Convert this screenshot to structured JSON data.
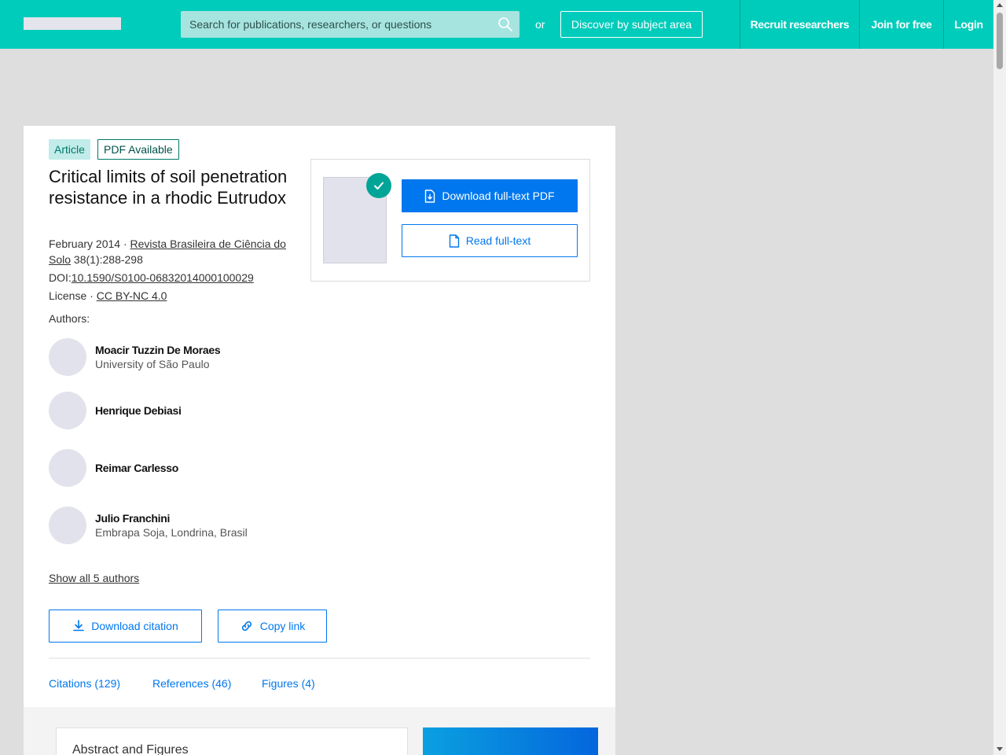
{
  "header": {
    "search_placeholder": "Search for publications, researchers, or questions",
    "or_text": "or",
    "discover_label": "Discover by subject area",
    "nav": {
      "recruit": "Recruit researchers",
      "join": "Join for free",
      "login": "Login"
    }
  },
  "article": {
    "badges": {
      "type": "Article",
      "pdf": "PDF Available"
    },
    "title": "Critical limits of soil penetration resistance in a rhodic Eutrudox",
    "date": "February 2014",
    "separator": " · ",
    "journal": "Revista Brasileira de Ciência do Solo",
    "volume": " 38(1):288-298",
    "doi_label": "DOI:",
    "doi": "10.1590/S0100-06832014000100029",
    "license_label": "License · ",
    "license": "CC BY-NC 4.0",
    "authors_label": "Authors:",
    "authors": [
      {
        "name": "Moacir Tuzzin De Moraes",
        "affiliation": "University of São Paulo"
      },
      {
        "name": "Henrique Debiasi",
        "affiliation": ""
      },
      {
        "name": "Reimar Carlesso",
        "affiliation": ""
      },
      {
        "name": "Julio Franchini",
        "affiliation": "Embrapa Soja, Londrina, Brasil"
      }
    ],
    "show_all": "Show all 5 authors",
    "download_citation": "Download citation",
    "copy_link": "Copy link",
    "tabs": {
      "citations": "Citations (129)",
      "references": "References (46)",
      "figures": "Figures (4)"
    }
  },
  "preview": {
    "download_pdf": "Download full-text PDF",
    "read_fulltext": "Read full-text"
  },
  "lower": {
    "abstract_heading": "Abstract and Figures"
  },
  "colors": {
    "brand": "#00ccbb",
    "accent_blue": "#0077ee",
    "teal_badge": "#00a597"
  }
}
